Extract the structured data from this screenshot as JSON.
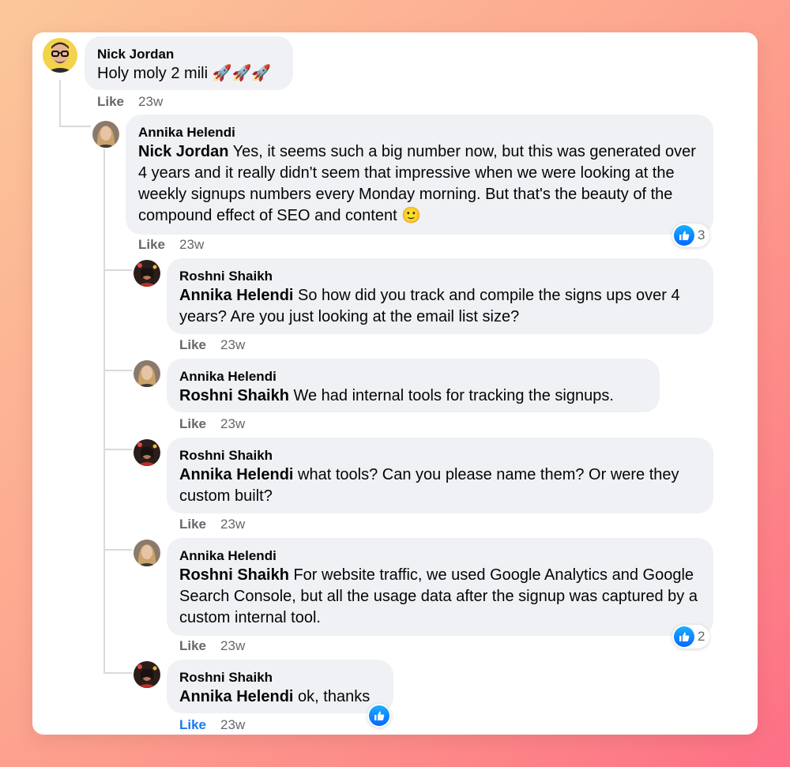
{
  "like_label": "Like",
  "comments": [
    {
      "author": "Nick Jordan",
      "mention": "",
      "text": "Holy moly 2 mili 🚀🚀🚀",
      "time": "23w",
      "liked": false,
      "reactions": null
    },
    {
      "author": "Annika Helendi",
      "mention": "Nick Jordan",
      "text": " Yes, it seems such a big number now, but this was generated over 4 years and it really didn't seem that impressive when we were looking at the weekly signups numbers every Monday morning. But that's the beauty of the compound effect of SEO and content 🙂",
      "time": "23w",
      "liked": false,
      "reactions": "3"
    },
    {
      "author": "Roshni Shaikh",
      "mention": "Annika Helendi",
      "text": " So how did you track and compile the signs ups over 4 years? Are you just looking at the email list size?",
      "time": "23w",
      "liked": false,
      "reactions": null
    },
    {
      "author": "Annika Helendi",
      "mention": "Roshni Shaikh",
      "text": " We had internal tools for tracking the signups.",
      "time": "23w",
      "liked": false,
      "reactions": null
    },
    {
      "author": "Roshni Shaikh",
      "mention": "Annika Helendi",
      "text": " what tools? Can you please name them? Or were they custom built?",
      "time": "23w",
      "liked": false,
      "reactions": null
    },
    {
      "author": "Annika Helendi",
      "mention": "Roshni Shaikh",
      "text": " For website traffic, we used Google Analytics and Google Search Console, but all the usage data after the signup was captured by a custom internal tool.",
      "time": "23w",
      "liked": false,
      "reactions": "2"
    },
    {
      "author": "Roshni Shaikh",
      "mention": "Annika Helendi",
      "text": " ok, thanks",
      "time": "23w",
      "liked": true,
      "reactions": ""
    }
  ],
  "colors": {
    "like_active": "#1877f2",
    "bubble": "#eff1f5",
    "meta_text": "#65676b"
  }
}
